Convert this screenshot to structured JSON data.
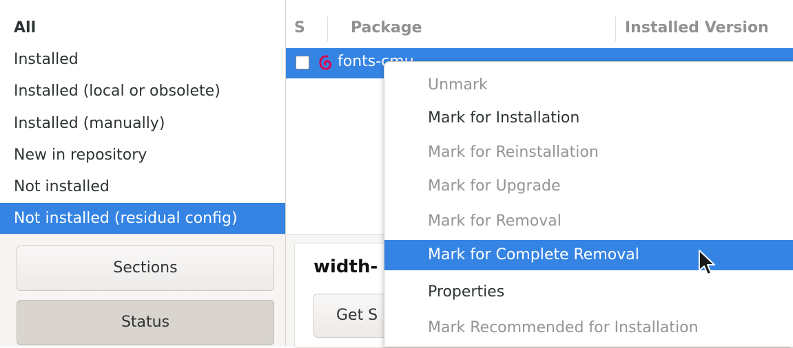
{
  "filters": {
    "items": [
      {
        "label": "All",
        "bold": true,
        "selected": false
      },
      {
        "label": "Installed",
        "bold": false,
        "selected": false
      },
      {
        "label": "Installed (local or obsolete)",
        "bold": false,
        "selected": false
      },
      {
        "label": "Installed (manually)",
        "bold": false,
        "selected": false
      },
      {
        "label": "New in repository",
        "bold": false,
        "selected": false
      },
      {
        "label": "Not installed",
        "bold": false,
        "selected": false
      },
      {
        "label": "Not installed (residual config)",
        "bold": false,
        "selected": true
      }
    ]
  },
  "side_buttons": {
    "sections": "Sections",
    "status": "Status"
  },
  "table": {
    "columns": [
      "S",
      "Package",
      "Installed Version"
    ],
    "rows": [
      {
        "name": "fonts-cmu...",
        "checked": false,
        "icon": "debian-swirl-icon"
      }
    ]
  },
  "details": {
    "title": "width-",
    "button": "Get S"
  },
  "context_menu": {
    "items": [
      {
        "label": "Unmark",
        "enabled": false,
        "active": false
      },
      {
        "label": "Mark for Installation",
        "enabled": true,
        "active": false
      },
      {
        "label": "Mark for Reinstallation",
        "enabled": false,
        "active": false
      },
      {
        "label": "Mark for Upgrade",
        "enabled": false,
        "active": false
      },
      {
        "label": "Mark for Removal",
        "enabled": false,
        "active": false
      },
      {
        "label": "Mark for Complete Removal",
        "enabled": true,
        "active": true
      },
      {
        "label": "Properties",
        "enabled": true,
        "active": false
      },
      {
        "label": "Mark Recommended for Installation",
        "enabled": false,
        "active": false
      }
    ]
  },
  "colors": {
    "selection": "#3584e4",
    "debian_red": "#d70751"
  }
}
